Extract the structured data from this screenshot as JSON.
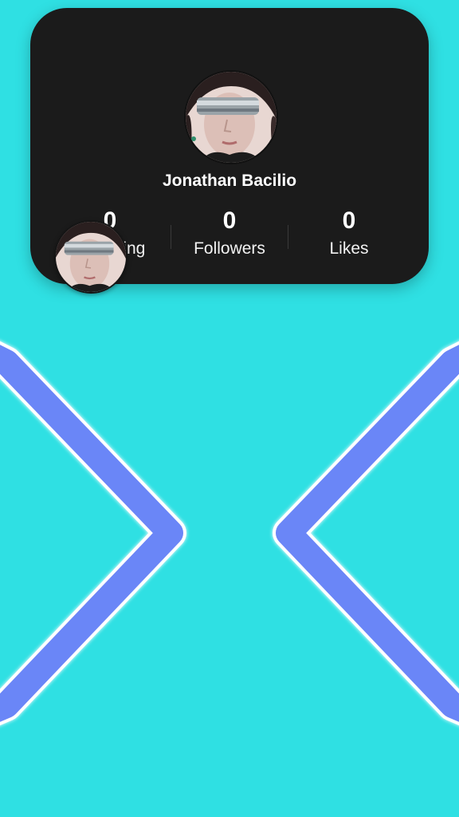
{
  "profile": {
    "name": "Jonathan Bacilio"
  },
  "stats": {
    "following": {
      "value": "0",
      "label": "Following"
    },
    "followers": {
      "value": "0",
      "label": "Followers"
    },
    "likes": {
      "value": "0",
      "label": "Likes"
    }
  },
  "colors": {
    "background": "#2fe0e3",
    "card": "#1b1b1b",
    "chevron": "#6b86f7"
  },
  "icons": {
    "left_chevron": "chevron-left-icon",
    "right_chevron": "chevron-right-icon"
  }
}
